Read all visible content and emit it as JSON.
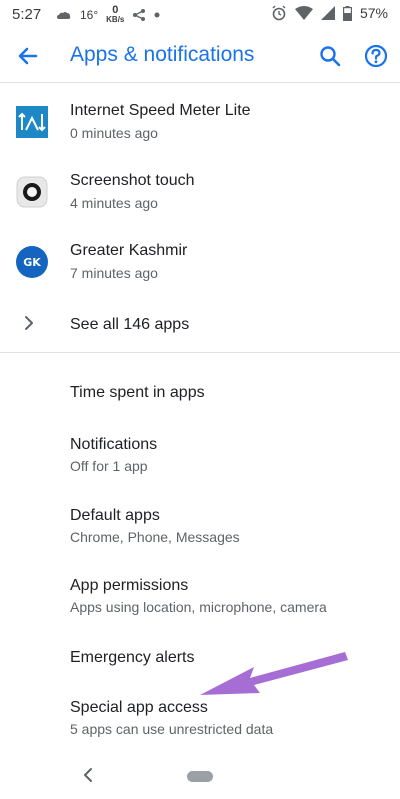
{
  "status_bar": {
    "time": "5:27",
    "temperature": "16°",
    "speed_value": "0",
    "speed_unit": "KB/s",
    "battery_percent": "57%",
    "icons": [
      "weather-icon",
      "share-icon",
      "dot-icon",
      "alarm-icon",
      "wifi-icon",
      "signal-icon",
      "battery-icon"
    ]
  },
  "app_bar": {
    "title": "Apps & notifications",
    "accent_color": "#1a73e8"
  },
  "recent_apps": [
    {
      "name": "Internet Speed Meter Lite",
      "time": "0 minutes ago",
      "icon": "speed-meter-icon"
    },
    {
      "name": "Screenshot touch",
      "time": "4 minutes ago",
      "icon": "screenshot-touch-icon"
    },
    {
      "name": "Greater Kashmir",
      "time": "7 minutes ago",
      "icon": "greater-kashmir-icon",
      "icon_text": "GK"
    }
  ],
  "see_all": {
    "label": "See all 146 apps"
  },
  "settings": [
    {
      "title": "Time spent in apps",
      "subtitle": ""
    },
    {
      "title": "Notifications",
      "subtitle": "Off for 1 app"
    },
    {
      "title": "Default apps",
      "subtitle": "Chrome, Phone, Messages"
    },
    {
      "title": "App permissions",
      "subtitle": "Apps using location, microphone, camera"
    },
    {
      "title": "Emergency alerts",
      "subtitle": ""
    },
    {
      "title": "Special app access",
      "subtitle": "5 apps can use unrestricted data"
    }
  ],
  "annotation": {
    "color": "#a66dd4"
  }
}
